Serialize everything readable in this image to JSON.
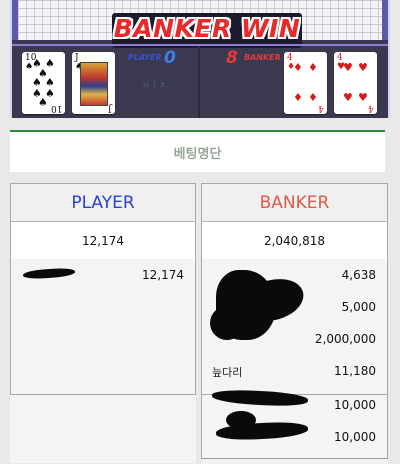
{
  "game": {
    "result": "BANKER WIN",
    "player_label": "PLAYER",
    "player_score": "0",
    "banker_label": "BANKER",
    "banker_score": "8",
    "faded_text": "ㅂㅏㅊ",
    "player_cards": [
      {
        "rank": "10",
        "suit": "♠",
        "color": "#111111"
      },
      {
        "rank": "J",
        "suit": "♠",
        "color": "#111111"
      }
    ],
    "banker_cards": [
      {
        "rank": "4",
        "suit": "♦",
        "color": "#d41d1d"
      },
      {
        "rank": "4",
        "suit": "♥",
        "color": "#d41d1d"
      }
    ]
  },
  "section": {
    "title": "베팅명단"
  },
  "player_panel": {
    "title": "PLAYER",
    "total": "12,174",
    "rows": [
      {
        "name": "",
        "amount": "12,174"
      }
    ]
  },
  "banker_panel": {
    "title": "BANKER",
    "total": "2,040,818",
    "rows": [
      {
        "name": "",
        "amount": "4,638"
      },
      {
        "name": "",
        "amount": "5,000"
      },
      {
        "name": "",
        "amount": "2,000,000"
      },
      {
        "name": "늪다리",
        "amount": "11,180"
      },
      {
        "name": "",
        "amount": "10,000"
      },
      {
        "name": "",
        "amount": "10,000"
      }
    ]
  }
}
